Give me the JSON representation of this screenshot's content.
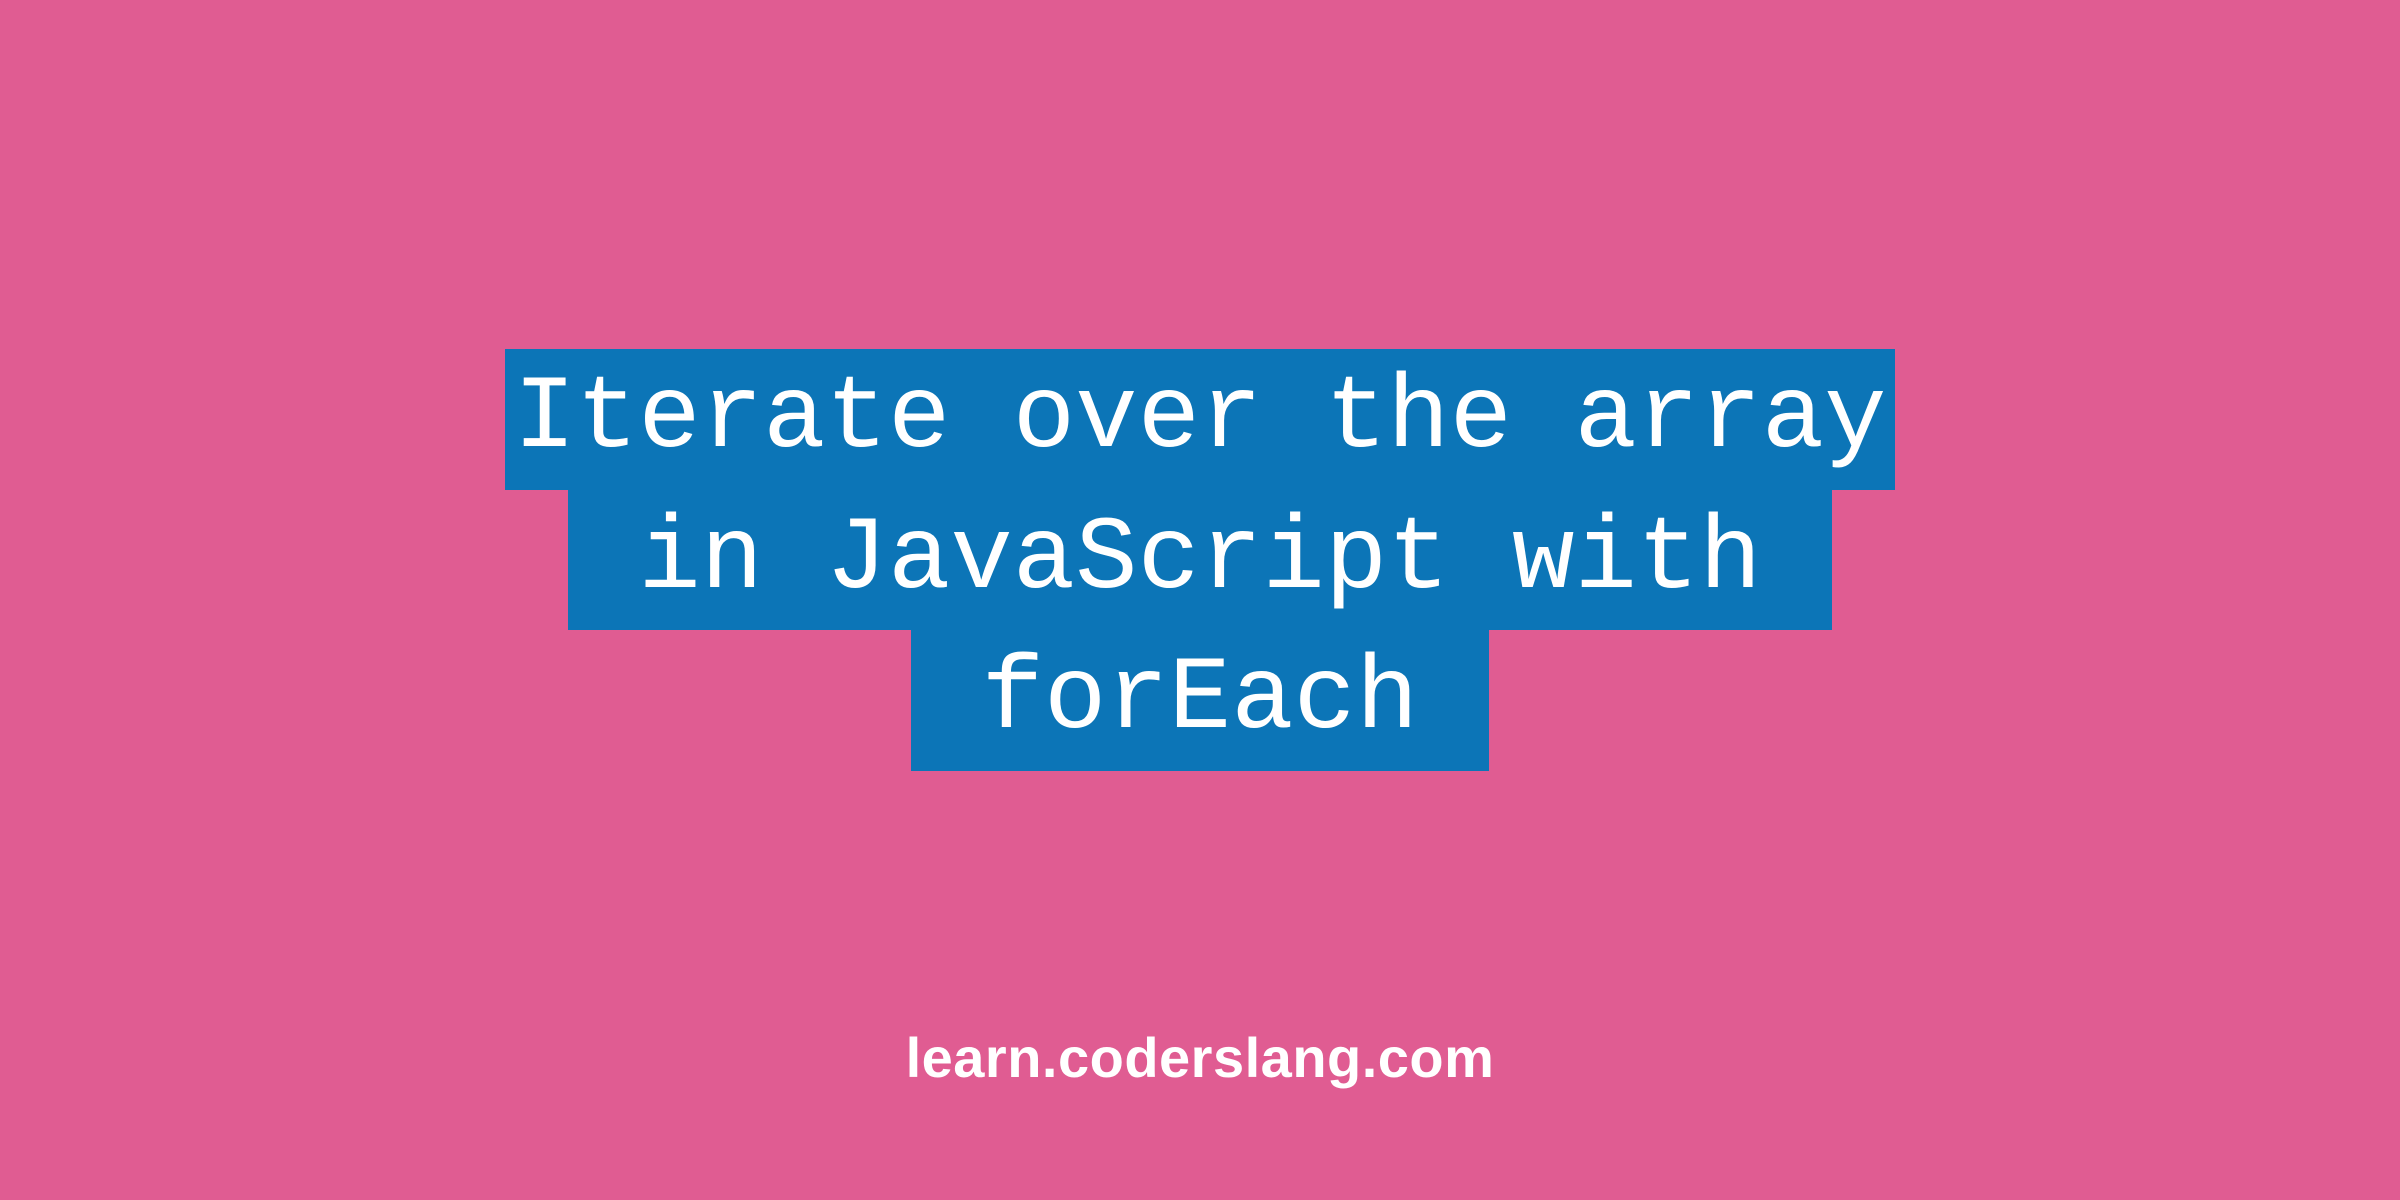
{
  "title": {
    "line1": "Iterate over the array",
    "line2": " in JavaScript with ",
    "line3": " forEach "
  },
  "footer": {
    "text": "learn.coderslang.com"
  },
  "colors": {
    "background": "#e05c92",
    "highlight": "#0c75b7",
    "text": "#ffffff"
  }
}
